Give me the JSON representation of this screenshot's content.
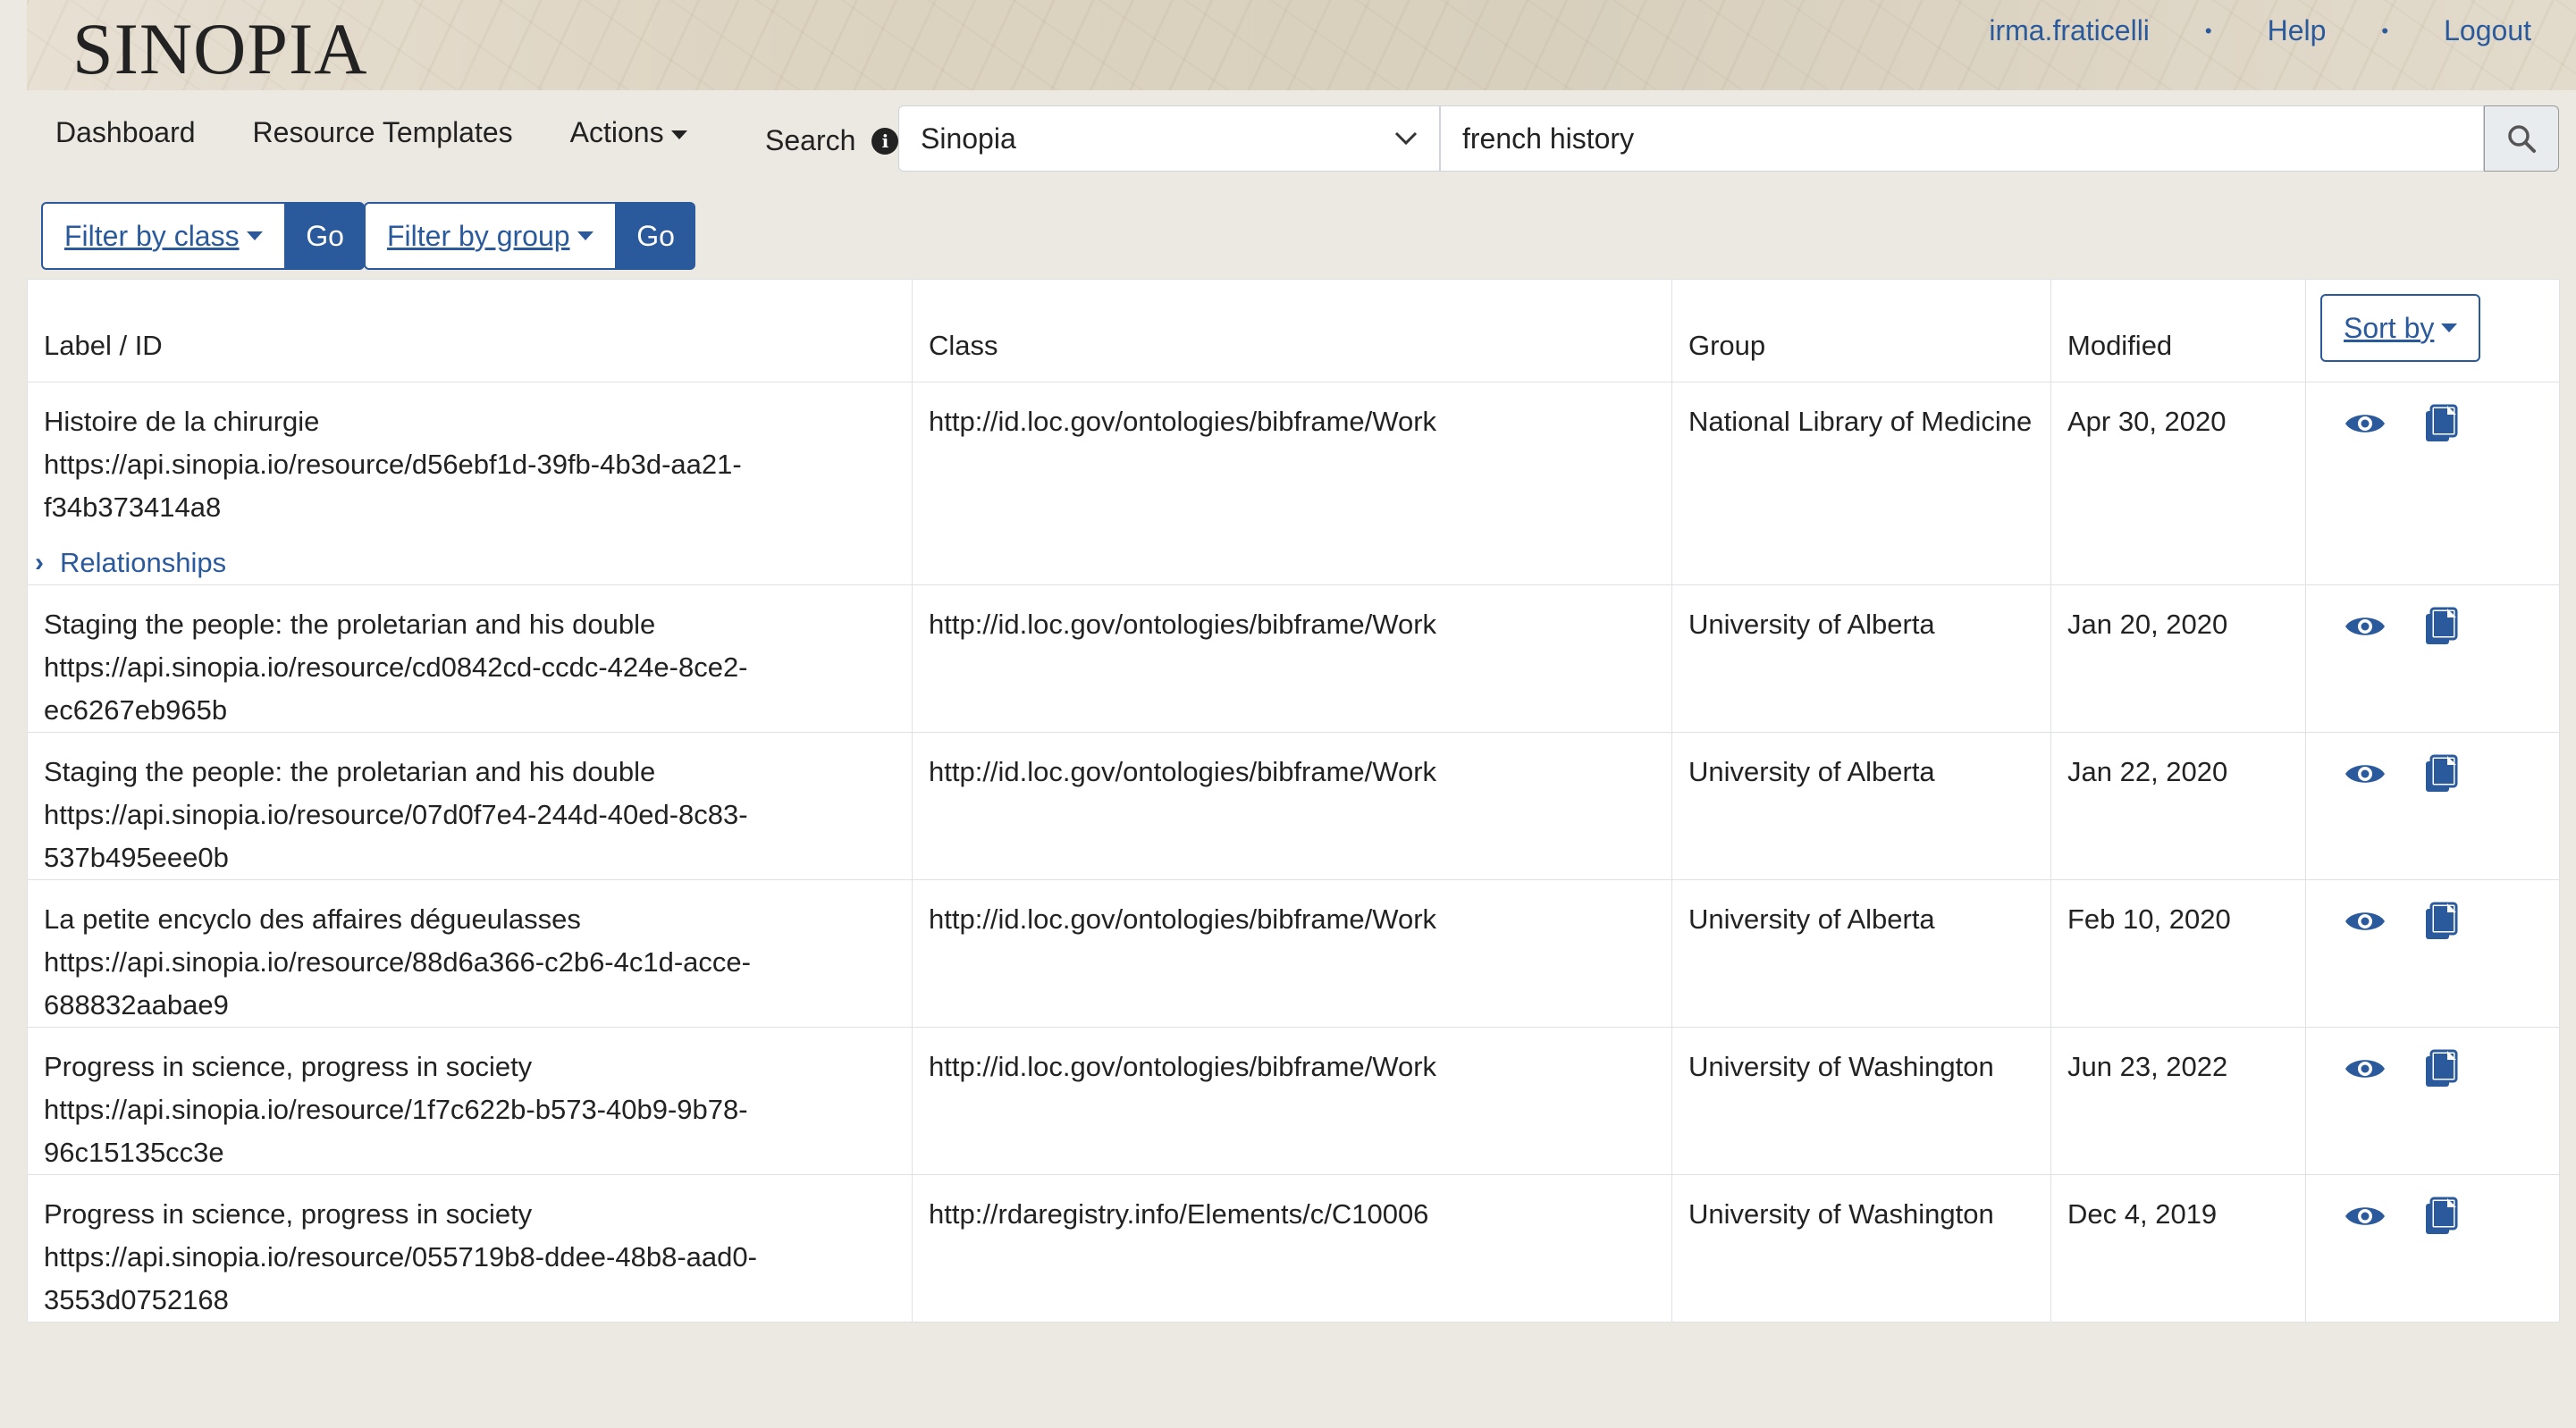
{
  "header": {
    "logo": "SINOPIA",
    "user": "irma.fraticelli",
    "help": "Help",
    "logout": "Logout",
    "separator": "•"
  },
  "nav": {
    "dashboard": "Dashboard",
    "resource_templates": "Resource Templates",
    "actions": "Actions"
  },
  "search": {
    "label": "Search",
    "scope": "Sinopia",
    "query": "french history"
  },
  "filters": {
    "class_label": "Filter by class",
    "group_label": "Filter by group",
    "go_label": "Go"
  },
  "table": {
    "headers": [
      "Label / ID",
      "Class",
      "Group",
      "Modified"
    ],
    "sort_label": "Sort by",
    "relationships_label": "Relationships",
    "rows": [
      {
        "label": "Histoire de la chirurgie",
        "id1": "https://api.sinopia.io/resource/d56ebf1d-39fb-4b3d-aa21-",
        "id2": "f34b373414a8",
        "class": "http://id.loc.gov/ontologies/bibframe/Work",
        "group": "National Library of Medicine",
        "modified": "Apr 30, 2020"
      },
      {
        "label": "Staging the people: the proletarian and his double",
        "id1": "https://api.sinopia.io/resource/cd0842cd-ccdc-424e-8ce2-",
        "id2": "ec6267eb965b",
        "class": "http://id.loc.gov/ontologies/bibframe/Work",
        "group": "University of Alberta",
        "modified": "Jan 20, 2020"
      },
      {
        "label": "Staging the people: the proletarian and his double",
        "id1": "https://api.sinopia.io/resource/07d0f7e4-244d-40ed-8c83-",
        "id2": "537b495eee0b",
        "class": "http://id.loc.gov/ontologies/bibframe/Work",
        "group": "University of Alberta",
        "modified": "Jan 22, 2020"
      },
      {
        "label": "La petite encyclo des affaires dégueulasses",
        "id1": "https://api.sinopia.io/resource/88d6a366-c2b6-4c1d-acce-",
        "id2": "688832aabae9",
        "class": "http://id.loc.gov/ontologies/bibframe/Work",
        "group": "University of Alberta",
        "modified": "Feb 10, 2020"
      },
      {
        "label": "Progress in science, progress in society",
        "id1": "https://api.sinopia.io/resource/1f7c622b-b573-40b9-9b78-",
        "id2": "96c15135cc3e",
        "class": "http://id.loc.gov/ontologies/bibframe/Work",
        "group": "University of Washington",
        "modified": "Jun 23, 2022"
      },
      {
        "label": "Progress in science, progress in society",
        "id1": "https://api.sinopia.io/resource/055719b8-ddee-48b8-aad0-",
        "id2": "3553d0752168",
        "class": "http://rdaregistry.info/Elements/c/C10006",
        "group": "University of Washington",
        "modified": "Dec 4, 2019"
      }
    ]
  }
}
